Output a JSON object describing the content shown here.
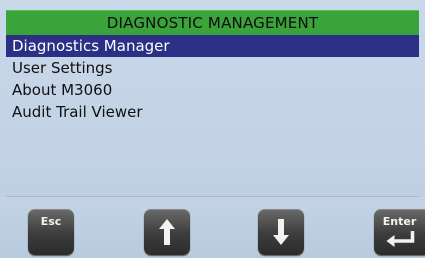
{
  "title_bar": {
    "title": "DIAGNOSTIC MANAGEMENT"
  },
  "menu": {
    "items": [
      {
        "label": "Diagnostics Manager",
        "selected": true
      },
      {
        "label": "User Settings",
        "selected": false
      },
      {
        "label": "About M3060",
        "selected": false
      },
      {
        "label": "Audit Trail Viewer",
        "selected": false
      }
    ]
  },
  "softkeys": {
    "esc_label": "Esc",
    "up_icon": "arrow-up-icon",
    "down_icon": "arrow-down-icon",
    "enter_label": "Enter",
    "enter_icon": "return-arrow-icon"
  },
  "colors": {
    "title_bar": "#3aa33a",
    "selection": "#2b2f86",
    "background": "#c9d9ea",
    "key": "#3c3c3c"
  }
}
